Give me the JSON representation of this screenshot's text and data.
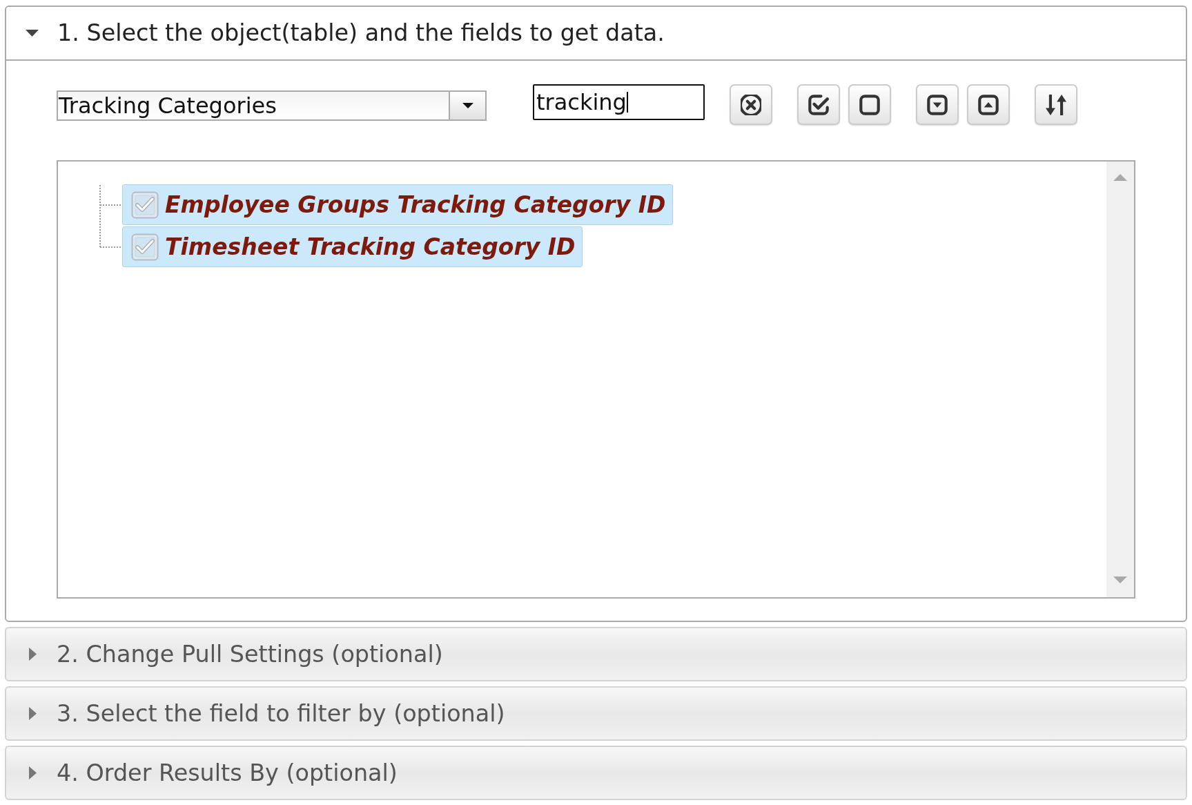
{
  "sections": [
    {
      "title": "1. Select the object(table) and the fields to get data.",
      "expanded": true,
      "object_select": {
        "value": "Tracking Categories"
      },
      "search": {
        "value": "tracking",
        "focused": true
      },
      "toolbar_groups": [
        {
          "buttons": [
            {
              "kind": "clear"
            }
          ]
        },
        {
          "buttons": [
            {
              "kind": "check"
            },
            {
              "kind": "uncheck"
            }
          ]
        },
        {
          "buttons": [
            {
              "kind": "expand"
            },
            {
              "kind": "collapse"
            }
          ]
        },
        {
          "buttons": [
            {
              "kind": "sort"
            }
          ]
        }
      ],
      "fields": [
        {
          "label": "Employee Groups Tracking Category ID",
          "checked": true,
          "selected": true,
          "search_match": true
        },
        {
          "label": "Timesheet Tracking Category ID",
          "checked": true,
          "selected": true,
          "search_match": true
        }
      ]
    },
    {
      "title": "2. Change Pull Settings (optional)",
      "expanded": false
    },
    {
      "title": "3. Select the field to filter by (optional)",
      "expanded": false
    },
    {
      "title": "4. Order Results By (optional)",
      "expanded": false
    }
  ]
}
